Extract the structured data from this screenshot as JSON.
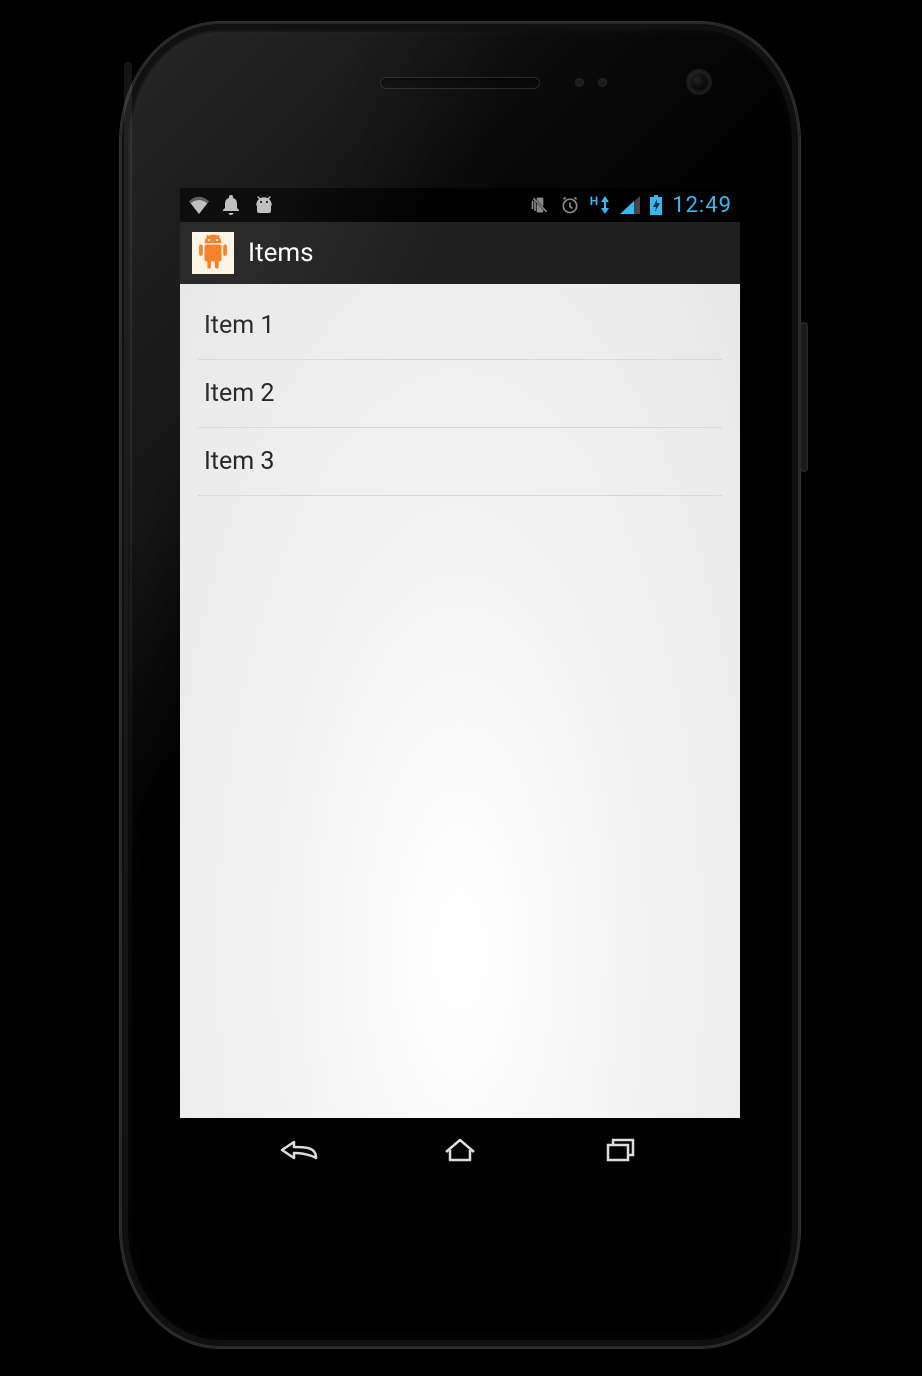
{
  "status_bar": {
    "left_icons": [
      "wifi-icon",
      "bell-icon",
      "android-debug-icon"
    ],
    "right_icons": [
      "vibrate-icon",
      "alarm-icon",
      "hspa-icon",
      "signal-icon",
      "battery-charging-icon"
    ],
    "network_label": "H",
    "clock": "12:49"
  },
  "action_bar": {
    "app_icon": "android-robot-icon",
    "app_icon_color": "#f47c20",
    "title": "Items"
  },
  "list": {
    "items": [
      {
        "label": "Item 1"
      },
      {
        "label": "Item 2"
      },
      {
        "label": "Item 3"
      }
    ]
  },
  "nav_bar": {
    "buttons": [
      "back",
      "home",
      "recents"
    ]
  }
}
